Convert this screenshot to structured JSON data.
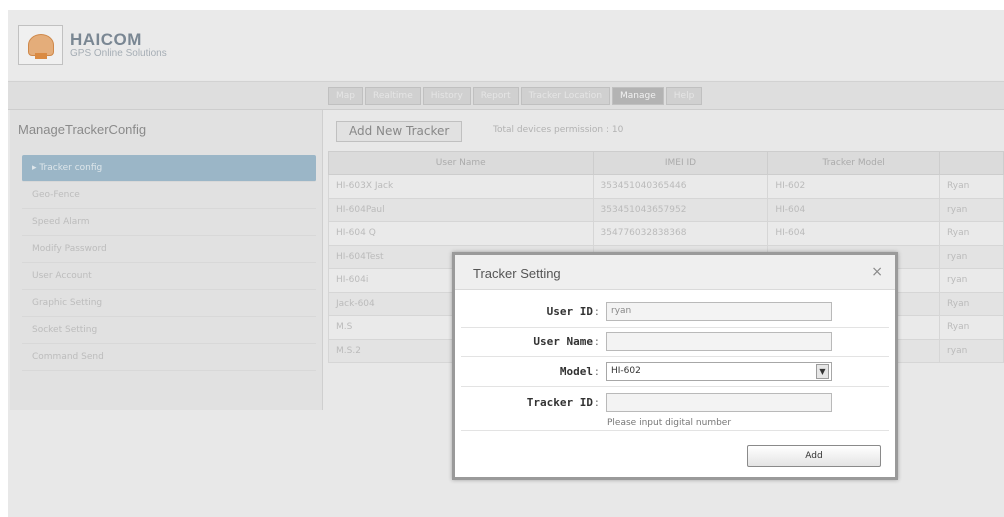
{
  "header": {
    "brand": "HAICOM",
    "tagline": "GPS Online Solutions"
  },
  "nav": {
    "tabs": [
      {
        "label": "Map"
      },
      {
        "label": "Realtime"
      },
      {
        "label": "History"
      },
      {
        "label": "Report"
      },
      {
        "label": "Tracker Location"
      },
      {
        "label": "Manage",
        "active": true
      },
      {
        "label": "Help"
      }
    ]
  },
  "sidebar": {
    "title": "ManageTrackerConfig",
    "items": [
      {
        "label": "▸ Tracker config",
        "active": true
      },
      {
        "label": "Geo-Fence"
      },
      {
        "label": "Speed Alarm"
      },
      {
        "label": "Modify Password"
      },
      {
        "label": "User Account"
      },
      {
        "label": "Graphic Setting"
      },
      {
        "label": "Socket Setting"
      },
      {
        "label": "Command Send"
      }
    ]
  },
  "main": {
    "add_tracker_label": "Add New Tracker",
    "total_note": "Total devices permission : 10",
    "table": {
      "columns": [
        "User Name",
        "IMEI ID",
        "Tracker Model",
        ""
      ],
      "rows": [
        [
          "HI-603X Jack",
          "353451040365446",
          "HI-602",
          "Ryan"
        ],
        [
          "HI-604Paul",
          "353451043657952",
          "HI-604",
          "ryan"
        ],
        [
          "HI-604 Q",
          "354776032838368",
          "HI-604",
          "Ryan"
        ],
        [
          "HI-604Test",
          "",
          "",
          "ryan"
        ],
        [
          "HI-604i",
          "",
          "",
          "ryan"
        ],
        [
          "Jack-604",
          "",
          "",
          "Ryan"
        ],
        [
          "M.S",
          "",
          "",
          "Ryan"
        ],
        [
          "M.S.2",
          "",
          "",
          "ryan"
        ]
      ]
    }
  },
  "dialog": {
    "title": "Tracker Setting",
    "close_glyph": "×",
    "fields": {
      "user_id": {
        "label": "User ID",
        "value": "ryan"
      },
      "user_name": {
        "label": "User Name",
        "value": ""
      },
      "model": {
        "label": "Model",
        "value": "HI-602"
      },
      "tracker_id": {
        "label": "Tracker ID",
        "value": ""
      }
    },
    "colon": ":",
    "hint": "Please input digital number",
    "add_label": "Add"
  }
}
